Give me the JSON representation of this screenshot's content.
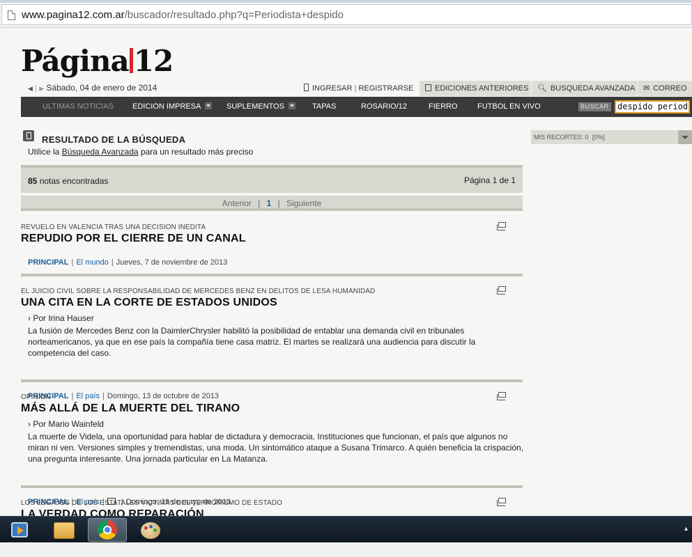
{
  "browser": {
    "url_domain": "www.pagina12.com.ar",
    "url_path": "/buscador/resultado.php?q=Periodista+despido"
  },
  "header": {
    "logo_left": "Página",
    "logo_right": "12",
    "date": "Sábado, 04 de enero de 2014",
    "ingresar": "INGRESAR",
    "registrarse": "REGISTRARSE",
    "ediciones": "EDICIONES ANTERIORES",
    "busqueda_avanzada": "BUSQUEDA AVANZADA",
    "correo": "CORREO"
  },
  "nav": {
    "ultimas": "ULTIMAS NOTICIAS",
    "edicion": "EDICION IMPRESA",
    "suplementos": "SUPLEMENTOS",
    "tapas": "TAPAS",
    "rosario": "ROSARIO/12",
    "fierro": "FIERRO",
    "futbol": "FUTBOL EN VIVO",
    "buscar_label": "BUSCAR",
    "search_value": "despido periodista"
  },
  "results": {
    "title": "RESULTADO DE LA BÚSQUEDA",
    "hint_pre": "Utilice la ",
    "hint_link": "Búsqueda Avanzada",
    "hint_post": " para un resultado más preciso",
    "count": "85",
    "count_label": "notas encontradas",
    "page_info": "Página 1 de 1",
    "prev": "Anterior",
    "page": "1",
    "next": "Siguiente"
  },
  "articles": [
    {
      "kicker": "REVUELO EN VALENCIA TRAS UNA DECISION INEDITA",
      "headline": "REPUDIO POR EL CIERRE DE UN CANAL",
      "section": "PRINCIPAL",
      "category": "El mundo",
      "date": "Jueves, 7 de noviembre de 2013"
    },
    {
      "kicker": "EL JUICIO CIVIL SOBRE LA RESPONSABILIDAD DE MERCEDES BENZ EN DELITOS DE LESA HUMANIDAD",
      "headline": "UNA CITA EN LA CORTE DE ESTADOS UNIDOS",
      "author": "› Por Irina Hauser",
      "summary": "La fusión de Mercedes Benz con la DaimlerChrysler habilitó la posibilidad de entablar una demanda civil en tribunales norteamericanos, ya que en ese país la compañía tiene casa matriz. El martes se realizará una audiencia para discutir la competencia del caso.",
      "section": "PRINCIPAL",
      "category": "El país",
      "date": "Domingo, 13 de octubre de 2013"
    },
    {
      "kicker": "OPINION",
      "headline": "MÁS ALLÁ DE LA MUERTE DEL TIRANO",
      "author": "› Por Mario Wainfeld",
      "summary": "La muerte de Videla, una oportunidad para hablar de dictadura y democracia. Instituciones que funcionan, el país que algunos no miran ni ven. Versiones simples y tremendistas, una moda. Un sintomático ataque a Susana Trimarco. A quién beneficia la crispación, una pregunta interesante. Una jornada particular en La Matanza.",
      "section": "PRINCIPAL",
      "category": "El país",
      "date": "Domingo, 19 de mayo de 2013"
    },
    {
      "kicker": "LOS LEGAJOS DE LOS ESTATALES VICTIMAS DEL TERRORISMO DE ESTADO",
      "headline": "LA VERDAD COMO REPARACIÓN"
    }
  ],
  "sidebar": {
    "recortes": "MIS RECORTES: 0",
    "recortes_pct": "[0%]"
  },
  "icons": [
    "page-icon",
    "mobile-icon",
    "book-icon",
    "search-icon",
    "mail-icon",
    "clip-icon",
    "photo-icon",
    "media-player-icon",
    "folder-icon",
    "chrome-icon",
    "paint-icon"
  ]
}
